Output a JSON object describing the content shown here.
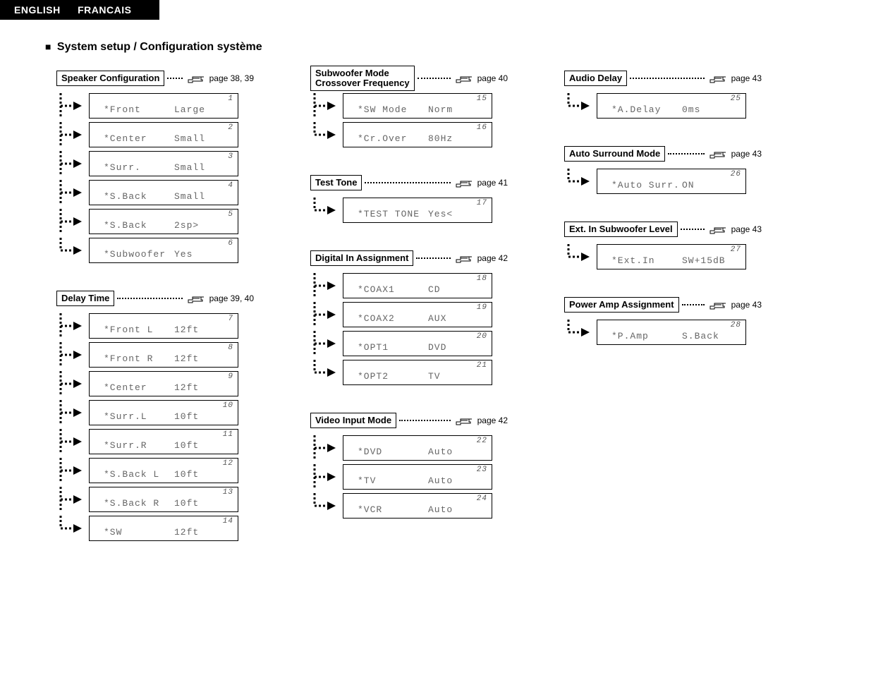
{
  "lang": {
    "en": "ENGLISH",
    "fr": "FRANCAIS"
  },
  "section_title": "System setup / Configuration système",
  "page_word": "page",
  "columns": [
    [
      {
        "label": "Speaker Configuration",
        "page_ref": "38, 39",
        "items": [
          {
            "num": "1",
            "label": "*Front",
            "value": "Large"
          },
          {
            "num": "2",
            "label": "*Center",
            "value": "Small"
          },
          {
            "num": "3",
            "label": "*Surr.",
            "value": "Small"
          },
          {
            "num": "4",
            "label": "*S.Back",
            "value": "Small"
          },
          {
            "num": "5",
            "label": "*S.Back",
            "value": "2sp>"
          },
          {
            "num": "6",
            "label": "*Subwoofer",
            "value": "Yes"
          }
        ]
      },
      {
        "label": "Delay Time",
        "page_ref": "39, 40",
        "items": [
          {
            "num": "7",
            "label": "*Front L",
            "value": "12ft"
          },
          {
            "num": "8",
            "label": "*Front R",
            "value": "12ft"
          },
          {
            "num": "9",
            "label": "*Center",
            "value": "12ft"
          },
          {
            "num": "10",
            "label": "*Surr.L",
            "value": "10ft"
          },
          {
            "num": "11",
            "label": "*Surr.R",
            "value": "10ft"
          },
          {
            "num": "12",
            "label": "*S.Back L",
            "value": "10ft"
          },
          {
            "num": "13",
            "label": "*S.Back R",
            "value": "10ft"
          },
          {
            "num": "14",
            "label": "*SW",
            "value": "12ft"
          }
        ]
      }
    ],
    [
      {
        "label": "Subwoofer Mode\nCrossover Frequency",
        "page_ref": "40",
        "items": [
          {
            "num": "15",
            "label": "*SW Mode",
            "value": "Norm"
          },
          {
            "num": "16",
            "label": "*Cr.Over",
            "value": "80Hz"
          }
        ]
      },
      {
        "label": "Test Tone",
        "page_ref": "41",
        "items": [
          {
            "num": "17",
            "label": "*TEST TONE",
            "value": "Yes<"
          }
        ]
      },
      {
        "label": "Digital In Assignment",
        "page_ref": "42",
        "items": [
          {
            "num": "18",
            "label": "*COAX1",
            "value": "CD"
          },
          {
            "num": "19",
            "label": "*COAX2",
            "value": "AUX"
          },
          {
            "num": "20",
            "label": "*OPT1",
            "value": "DVD"
          },
          {
            "num": "21",
            "label": "*OPT2",
            "value": "TV"
          }
        ]
      },
      {
        "label": "Video Input Mode",
        "page_ref": "42",
        "items": [
          {
            "num": "22",
            "label": "*DVD",
            "value": "Auto"
          },
          {
            "num": "23",
            "label": "*TV",
            "value": "Auto"
          },
          {
            "num": "24",
            "label": "*VCR",
            "value": "Auto"
          }
        ]
      }
    ],
    [
      {
        "label": "Audio Delay",
        "page_ref": "43",
        "items": [
          {
            "num": "25",
            "label": "*A.Delay",
            "value": "0ms"
          }
        ]
      },
      {
        "label": "Auto Surround Mode",
        "page_ref": "43",
        "items": [
          {
            "num": "26",
            "label": "*Auto Surr.",
            "value": "ON"
          }
        ]
      },
      {
        "label": "Ext. In Subwoofer Level",
        "page_ref": "43",
        "items": [
          {
            "num": "27",
            "label": "*Ext.In",
            "value": "SW+15dB"
          }
        ]
      },
      {
        "label": "Power Amp Assignment",
        "page_ref": "43",
        "items": [
          {
            "num": "28",
            "label": "*P.Amp",
            "value": "S.Back"
          }
        ]
      }
    ]
  ]
}
